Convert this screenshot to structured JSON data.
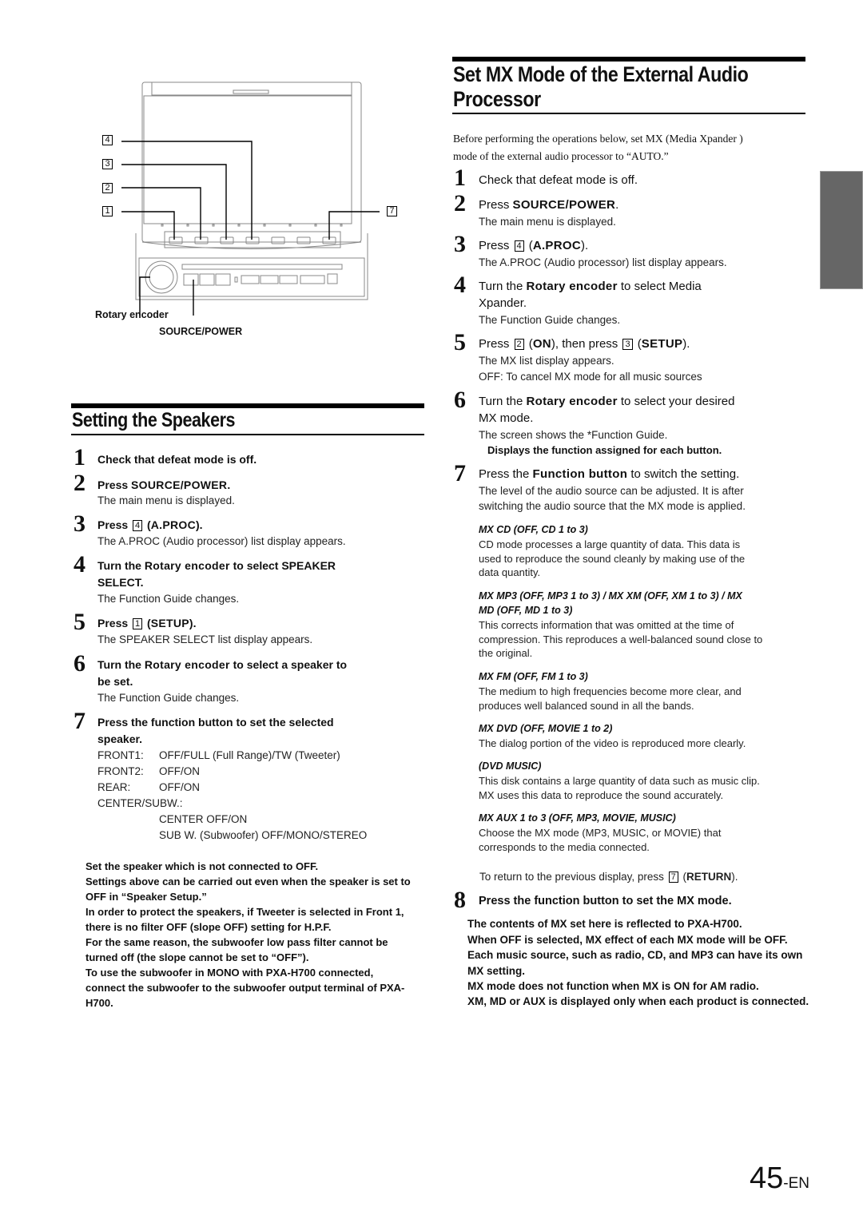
{
  "diagram": {
    "callouts": [
      "4",
      "3",
      "2",
      "1",
      "7"
    ],
    "rotary_label": "Rotary encoder",
    "source_label": "SOURCE/POWER"
  },
  "mx_section": {
    "title_line1": "Set MX Mode of the External Audio",
    "title_line2": "Processor",
    "intro_line1": "Before performing the operations below, set MX (Media Xpander )",
    "intro_line2": "mode of the external audio processor to “AUTO.”",
    "steps": [
      {
        "num": "1",
        "pre": "Check that defeat mode is off.",
        "desc": []
      },
      {
        "num": "2",
        "pre": "Press ",
        "bold": "SOURCE/POWER",
        "post": ".",
        "desc": [
          "The main menu is displayed."
        ]
      },
      {
        "num": "3",
        "pre": "Press ",
        "key": "4",
        "bold": "A.PROC",
        "post": ").",
        "desc": [
          "The A.PROC (Audio processor) list display appears."
        ]
      },
      {
        "num": "4",
        "pre": "Turn the ",
        "bold": "Rotary encoder",
        "post": " to select  Media",
        "line2": "Xpander.",
        "desc": [
          "The Function Guide changes."
        ]
      },
      {
        "num": "5",
        "pre": "Press ",
        "key": "2",
        "bold": "ON",
        "mid": "), then press ",
        "key2": "3",
        "bold2": "SETUP",
        "post": ").",
        "desc": [
          "The MX list display appears.",
          "OFF: To cancel MX mode for all music sources"
        ]
      },
      {
        "num": "6",
        "pre": "Turn the ",
        "bold": "Rotary encoder",
        "post": " to select your desired",
        "line2": "MX mode.",
        "desc": [
          "The screen shows the *Function Guide."
        ],
        "desc_bold": "Displays the function assigned for each button."
      },
      {
        "num": "7",
        "pre": "Press the ",
        "bold": "Function button",
        "post": " to switch the setting.",
        "desc": [
          "The level of the audio source can be adjusted. It is after",
          "switching the audio source that the MX mode is applied."
        ]
      },
      {
        "num": "8",
        "title": "Press the function button to set the MX mode."
      }
    ],
    "modes": [
      {
        "title": "MX CD (OFF, CD 1 to 3)",
        "lines": [
          "CD mode processes a large quantity of data. This data is",
          "used to reproduce the sound cleanly by making use of the",
          "data quantity."
        ]
      },
      {
        "title": "MX MP3 (OFF, MP3 1 to 3) / MX XM (OFF, XM 1 to 3) / MX",
        "title2": "MD (OFF, MD 1 to 3)",
        "lines": [
          "This corrects information that was omitted at the time of",
          "compression. This reproduces a well-balanced sound close to",
          "the original."
        ]
      },
      {
        "title": "MX FM (OFF, FM 1 to 3)",
        "lines": [
          "The medium to high frequencies become more clear, and",
          "produces well balanced sound in all the bands."
        ]
      },
      {
        "title": "MX DVD (OFF, MOVIE 1 to 2)",
        "lines": [
          "The dialog portion of the video is reproduced more clearly."
        ]
      },
      {
        "title": "(DVD MUSIC)",
        "lines": [
          "This disk contains a large quantity of data such as music clip.",
          "MX uses this data to reproduce the sound accurately."
        ]
      },
      {
        "title": "MX AUX 1 to 3 (OFF, MP3, MOVIE, MUSIC)",
        "lines": [
          "Choose the MX mode (MP3, MUSIC, or MOVIE) that",
          "corresponds to the media connected."
        ]
      }
    ],
    "return_pre": "To return to the previous display, press ",
    "return_key": "7",
    "return_bold": "RETURN",
    "return_post": ").",
    "notes": [
      "The contents of MX set here is reflected to PXA-H700.",
      "When OFF is selected, MX effect of each MX mode will be OFF.",
      "Each music source, such as radio, CD, and MP3 can have its own",
      "MX setting.",
      "MX mode does not function when MX is ON for AM radio.",
      "XM, MD or AUX is displayed only when each product is connected."
    ]
  },
  "speakers_section": {
    "title": "Setting the Speakers",
    "steps": [
      {
        "num": "1",
        "pre": "Check that defeat mode is off.",
        "desc": []
      },
      {
        "num": "2",
        "pre": "Press ",
        "bold": "SOURCE/POWER",
        "post": ".",
        "desc": [
          "The main menu is displayed."
        ]
      },
      {
        "num": "3",
        "pre": "Press ",
        "key": "4",
        "bold": "A.PROC",
        "post": ").",
        "desc": [
          "The A.PROC (Audio processor) list display appears."
        ]
      },
      {
        "num": "4",
        "pre": "Turn the ",
        "bold": "Rotary encoder",
        "post": " to select SPEAKER",
        "line2": "SELECT.",
        "desc": [
          "The Function Guide changes."
        ]
      },
      {
        "num": "5",
        "pre": "Press ",
        "key": "1",
        "bold": "SETUP",
        "post": ").",
        "desc": [
          "The SPEAKER SELECT list display appears."
        ]
      },
      {
        "num": "6",
        "pre": "Turn the ",
        "bold": "Rotary encoder",
        "post": " to select a speaker to",
        "line2": "be set.",
        "desc": [
          "The Function Guide changes."
        ]
      },
      {
        "num": "7",
        "pre": "Press the function button to set the selected",
        "line2": "speaker."
      }
    ],
    "speaker_options": [
      {
        "label": "FRONT1:",
        "value": "OFF/FULL (Full Range)/TW (Tweeter)"
      },
      {
        "label": "FRONT2:",
        "value": "OFF/ON"
      },
      {
        "label": "REAR:",
        "value": "OFF/ON"
      },
      {
        "label": "CENTER/SUBW.:",
        "value": ""
      }
    ],
    "center_sub": [
      "CENTER OFF/ON",
      "SUB W. (Subwoofer) OFF/MONO/STEREO"
    ],
    "notes": [
      "Set the speaker which is not connected to OFF.",
      "Settings above can be carried out even when the speaker is set to",
      "OFF in “Speaker Setup.”",
      "In order to protect the speakers, if Tweeter is selected in Front 1,",
      "there is no filter OFF (slope OFF) setting for H.P.F.",
      "For the same reason, the subwoofer low pass filter cannot be",
      "turned off (the slope cannot be set to “OFF”).",
      "To use the subwoofer in MONO with PXA-H700 connected,",
      "connect the subwoofer to the subwoofer output terminal of PXA-",
      "H700."
    ]
  },
  "page_number": {
    "number": "45",
    "suffix": "-EN"
  },
  "colors": {
    "side_tab": "#666666"
  }
}
